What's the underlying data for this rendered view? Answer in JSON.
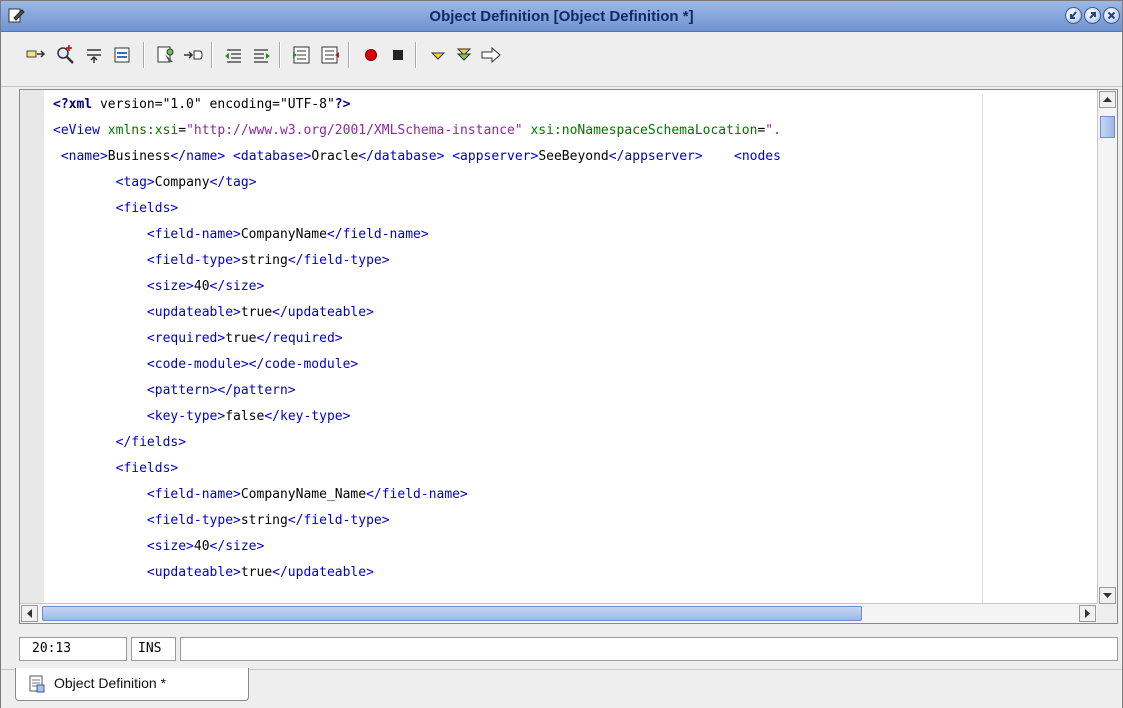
{
  "window": {
    "title": "Object Definition [Object Definition *]"
  },
  "toolbar": {
    "buttons": [
      "find-icon",
      "find-selection-icon",
      "previous-occurrence-icon",
      "next-occurrence-icon",
      "toggle-bookmark-icon",
      "next-bookmark-icon",
      "shift-left-icon",
      "shift-right-icon",
      "comment-icon",
      "uncomment-icon",
      "record-macro-icon",
      "stop-macro-icon",
      "check-xml-icon",
      "validate-xml-icon",
      "transform-icon"
    ]
  },
  "editor": {
    "lines": [
      [
        [
          "pi",
          "<?xml"
        ],
        [
          "txt",
          " version=\"1.0\" encoding=\"UTF-8\""
        ],
        [
          "pi",
          "?>"
        ]
      ],
      [
        [
          "t",
          "<eView "
        ],
        [
          "attr",
          "xmlns:xsi"
        ],
        [
          "txt",
          "="
        ],
        [
          "val",
          "\"http://www.w3.org/2001/XMLSchema-instance\""
        ],
        [
          "txt",
          " "
        ],
        [
          "attr",
          "xsi:noNamespaceSchemaLocation"
        ],
        [
          "txt",
          "="
        ],
        [
          "val",
          "\"."
        ]
      ],
      [
        [
          "txt",
          " "
        ],
        [
          "t",
          "<name>"
        ],
        [
          "txt",
          "Business"
        ],
        [
          "t",
          "</name>"
        ],
        [
          "txt",
          " "
        ],
        [
          "t",
          "<database>"
        ],
        [
          "txt",
          "Oracle"
        ],
        [
          "t",
          "</database>"
        ],
        [
          "txt",
          " "
        ],
        [
          "t",
          "<appserver>"
        ],
        [
          "txt",
          "SeeBeyond"
        ],
        [
          "t",
          "</appserver>"
        ],
        [
          "txt",
          "    "
        ],
        [
          "t",
          "<nodes"
        ]
      ],
      [
        [
          "txt",
          "        "
        ],
        [
          "t",
          "<tag>"
        ],
        [
          "txt",
          "Company"
        ],
        [
          "t",
          "</tag>"
        ]
      ],
      [
        [
          "txt",
          "        "
        ],
        [
          "t",
          "<fields>"
        ]
      ],
      [
        [
          "txt",
          "            "
        ],
        [
          "t",
          "<field-name>"
        ],
        [
          "txt",
          "CompanyName"
        ],
        [
          "t",
          "</field-name>"
        ]
      ],
      [
        [
          "txt",
          "            "
        ],
        [
          "t",
          "<field-type>"
        ],
        [
          "txt",
          "string"
        ],
        [
          "t",
          "</field-type>"
        ]
      ],
      [
        [
          "txt",
          "            "
        ],
        [
          "t",
          "<size>"
        ],
        [
          "txt",
          "40"
        ],
        [
          "t",
          "</size>"
        ]
      ],
      [
        [
          "txt",
          "            "
        ],
        [
          "t",
          "<updateable>"
        ],
        [
          "txt",
          "true"
        ],
        [
          "t",
          "</updateable>"
        ]
      ],
      [
        [
          "txt",
          "            "
        ],
        [
          "t",
          "<required>"
        ],
        [
          "txt",
          "true"
        ],
        [
          "t",
          "</required>"
        ]
      ],
      [
        [
          "txt",
          "            "
        ],
        [
          "t",
          "<code-module></code-module>"
        ]
      ],
      [
        [
          "txt",
          "            "
        ],
        [
          "t",
          "<pattern></pattern>"
        ]
      ],
      [
        [
          "txt",
          "            "
        ],
        [
          "t",
          "<key-type>"
        ],
        [
          "txt",
          "false"
        ],
        [
          "t",
          "</key-type>"
        ]
      ],
      [
        [
          "txt",
          "        "
        ],
        [
          "t",
          "</fields>"
        ]
      ],
      [
        [
          "txt",
          "        "
        ],
        [
          "t",
          "<fields>"
        ]
      ],
      [
        [
          "txt",
          "            "
        ],
        [
          "t",
          "<field-name>"
        ],
        [
          "txt",
          "CompanyName_Name"
        ],
        [
          "t",
          "</field-name>"
        ]
      ],
      [
        [
          "txt",
          "            "
        ],
        [
          "t",
          "<field-type>"
        ],
        [
          "txt",
          "string"
        ],
        [
          "t",
          "</field-type>"
        ]
      ],
      [
        [
          "txt",
          "            "
        ],
        [
          "t",
          "<size>"
        ],
        [
          "txt",
          "40"
        ],
        [
          "t",
          "</size>"
        ]
      ],
      [
        [
          "txt",
          "            "
        ],
        [
          "t",
          "<updateable>"
        ],
        [
          "txt",
          "true"
        ],
        [
          "t",
          "</updateable>"
        ]
      ]
    ]
  },
  "status": {
    "position": "20:13",
    "mode": "INS",
    "message": ""
  },
  "tabs": [
    {
      "label": "Object Definition *"
    }
  ]
}
